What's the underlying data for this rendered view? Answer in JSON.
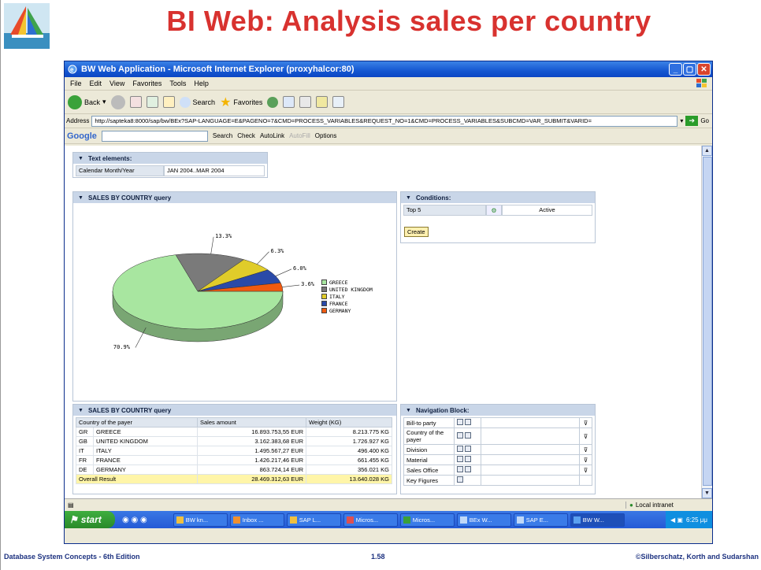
{
  "slide": {
    "title": "BI Web: Analysis sales per country",
    "footer_left": "Database System Concepts - 6th Edition",
    "footer_center": "1.58",
    "footer_right": "©Silberschatz, Korth and Sudarshan"
  },
  "window": {
    "title": "BW Web Application - Microsoft Internet Explorer (proxyhalcor:80)",
    "menu": [
      "File",
      "Edit",
      "View",
      "Favorites",
      "Tools",
      "Help"
    ],
    "toolbar": {
      "back": "Back",
      "search": "Search",
      "favorites": "Favorites"
    },
    "address_label": "Address",
    "url": "http://sapteka8:8000/sap/bw/BEx?SAP-LANGUAGE=E&PAGENO=7&CMD=PROCESS_VARIABLES&REQUEST_NO=1&CMD=PROCESS_VARIABLES&SUBCMD=VAR_SUBMIT&VARID=",
    "go": "Go",
    "google": {
      "logo": "Google",
      "search": "Search",
      "check": "Check",
      "autolink": "AutoLink",
      "autofill": "AutoFill",
      "options": "Options"
    }
  },
  "text_elements": {
    "header": "Text elements:",
    "label": "Calendar Month/Year",
    "value": "JAN 2004..MAR 2004"
  },
  "chart_panel": {
    "header": "SALES BY COUNTRY query"
  },
  "chart_data": {
    "type": "pie",
    "labels": [
      "GREECE",
      "UNITED KINGDOM",
      "ITALY",
      "FRANCE",
      "GERMANY"
    ],
    "values": [
      70.9,
      13.3,
      6.3,
      6.0,
      3.6
    ],
    "value_labels": [
      "70.9%",
      "13.3%",
      "6.3%",
      "6.0%",
      "3.6%"
    ],
    "colors": [
      "#a8e6a0",
      "#7a7a7a",
      "#e0cc2a",
      "#2a4aa8",
      "#f05a10"
    ],
    "legend_position": "right"
  },
  "conditions": {
    "header": "Conditions:",
    "name": "Top 5",
    "status": "Active",
    "create": "Create"
  },
  "table_panel": {
    "header": "SALES BY COUNTRY query",
    "columns": [
      "Country of the payer",
      "Sales amount",
      "Weight (KG)"
    ],
    "rows": [
      {
        "code": "GR",
        "country": "GREECE",
        "amount": "16.893.753,55 EUR",
        "weight": "8.213.775 KG"
      },
      {
        "code": "GB",
        "country": "UNITED KINGDOM",
        "amount": "3.162.383,68 EUR",
        "weight": "1.726.927 KG"
      },
      {
        "code": "IT",
        "country": "ITALY",
        "amount": "1.495.567,27 EUR",
        "weight": "496.400 KG"
      },
      {
        "code": "FR",
        "country": "FRANCE",
        "amount": "1.426.217,46 EUR",
        "weight": "661.455 KG"
      },
      {
        "code": "DE",
        "country": "GERMANY",
        "amount": "863.724,14 EUR",
        "weight": "356.021 KG"
      }
    ],
    "total": {
      "label": "Overall Result",
      "amount": "28.469.312,63 EUR",
      "weight": "13.640.028 KG"
    }
  },
  "navigation": {
    "header": "Navigation Block:",
    "items": [
      "Bill-to party",
      "Country of the payer",
      "Division",
      "Material",
      "Sales Office",
      "Key Figures"
    ]
  },
  "status": {
    "zone": "Local intranet"
  },
  "taskbar": {
    "start": "start",
    "items": [
      "BW kn...",
      "Inbox ...",
      "SAP L...",
      "Micros...",
      "Micros...",
      "BEx W...",
      "SAP E...",
      "BW W..."
    ],
    "clock": "6:25 μμ"
  }
}
